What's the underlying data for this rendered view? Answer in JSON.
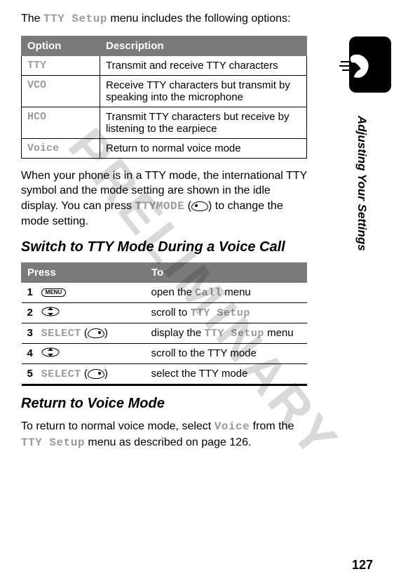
{
  "doc": {
    "watermark": "PRELIMINARY",
    "side_label": "Adjusting Your Settings",
    "page_number": "127"
  },
  "intro": {
    "pre": "The ",
    "menu_name": "TTY Setup",
    "post": " menu includes the following options:"
  },
  "options_table": {
    "headers": {
      "option": "Option",
      "description": "Description"
    },
    "rows": [
      {
        "opt": "TTY",
        "desc": "Transmit and receive TTY characters"
      },
      {
        "opt": "VCO",
        "desc": "Receive TTY characters but transmit by speaking into the microphone"
      },
      {
        "opt": "HCO",
        "desc": "Transmit TTY characters but receive by listening to the earpiece"
      },
      {
        "opt": "Voice",
        "desc": "Return to normal voice mode"
      }
    ]
  },
  "mode_note": {
    "pre": "When your phone is in a TTY mode, the international TTY symbol and the mode setting are shown in the idle display. You can press ",
    "key": "TTYMODE",
    "post": ") to change the mode setting."
  },
  "heading_switch": "Switch to TTY Mode During a Voice Call",
  "steps_table": {
    "headers": {
      "press": "Press",
      "to": "To"
    },
    "rows": [
      {
        "num": "1",
        "press_label": "MENU",
        "press_kind": "menu",
        "to_pre": "open the ",
        "to_mono": "Call",
        "to_post": " menu"
      },
      {
        "num": "2",
        "press_label": "",
        "press_kind": "scroll",
        "to_pre": "scroll to ",
        "to_mono": "TTY Setup",
        "to_post": ""
      },
      {
        "num": "3",
        "press_label": "SELECT",
        "press_kind": "soft-right",
        "to_pre": "display the ",
        "to_mono": "TTY Setup",
        "to_post": " menu"
      },
      {
        "num": "4",
        "press_label": "",
        "press_kind": "scroll",
        "to_pre": "scroll to the TTY mode",
        "to_mono": "",
        "to_post": ""
      },
      {
        "num": "5",
        "press_label": "SELECT",
        "press_kind": "soft-right",
        "to_pre": "select the TTY mode",
        "to_mono": "",
        "to_post": ""
      }
    ]
  },
  "heading_return": "Return to Voice Mode",
  "return_note": {
    "pre": "To return to normal voice mode, select ",
    "opt": "Voice",
    "mid": " from the ",
    "menu": "TTY Setup",
    "post": " menu as described on page 126."
  }
}
